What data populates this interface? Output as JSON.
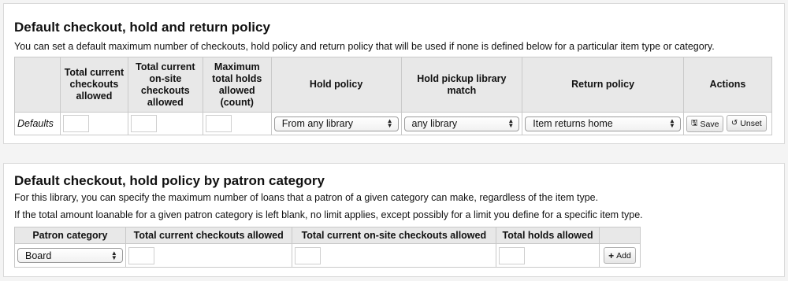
{
  "section1": {
    "title": "Default checkout, hold and return policy",
    "description": "You can set a default maximum number of checkouts, hold policy and return policy that will be used if none is defined below for a particular item type or category.",
    "headers": {
      "blank": "",
      "checkouts": "Total current checkouts allowed",
      "onsite": "Total current on-site checkouts allowed",
      "holds": "Maximum total holds allowed (count)",
      "hold_policy": "Hold policy",
      "pickup_match": "Hold pickup library match",
      "return_policy": "Return policy",
      "actions": "Actions"
    },
    "row": {
      "label": "Defaults",
      "checkouts_value": "",
      "onsite_value": "",
      "holds_value": "",
      "hold_policy_selected": "From any library",
      "pickup_match_selected": "any library",
      "return_policy_selected": "Item returns home",
      "save_label": "Save",
      "unset_label": "Unset"
    }
  },
  "section2": {
    "title": "Default checkout, hold policy by patron category",
    "description1": "For this library, you can specify the maximum number of loans that a patron of a given category can make, regardless of the item type.",
    "description2": "If the total amount loanable for a given patron category is left blank, no limit applies, except possibly for a limit you define for a specific item type.",
    "headers": {
      "category": "Patron category",
      "checkouts": "Total current checkouts allowed",
      "onsite": "Total current on-site checkouts allowed",
      "holds": "Total holds allowed",
      "blank": ""
    },
    "row": {
      "category_selected": "Board",
      "checkouts_value": "",
      "onsite_value": "",
      "holds_value": "",
      "add_label": "Add"
    }
  },
  "icons": {
    "select_arrows": "updown-arrows-icon",
    "save": "floppy-disk-icon",
    "unset": "undo-icon",
    "add": "plus-icon"
  }
}
